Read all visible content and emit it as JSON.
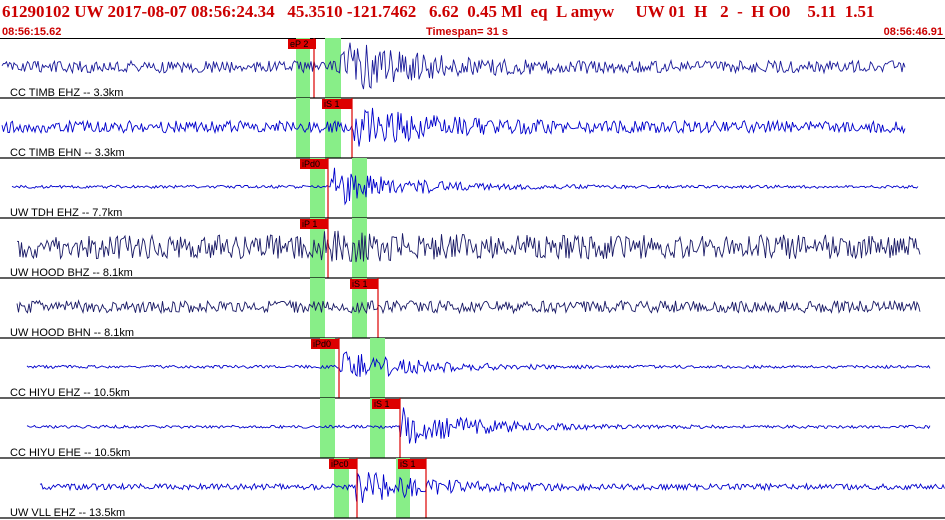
{
  "header": {
    "title": "61290102 UW 2017-08-07 08:56:24.34   45.3510 -121.7462   6.62  0.45 Ml  eq  L amyw     UW 01  H   2  -  H O0    5.11  1.51",
    "start_time": "08:56:15.62",
    "timespan": "Timespan=  31 s",
    "end_time": "08:56:46.91"
  },
  "colors": {
    "header_text": "#cc0000",
    "trace_blue": "#0000cc",
    "trace_navy": "#1a1a66",
    "pick_red": "#dd0000",
    "window_green": "#88ee88",
    "grid": "#000000"
  },
  "channels": [
    {
      "label": "CC TIMB EHZ -- 3.3km",
      "color": "navy-blue",
      "picks": [
        {
          "label": "eP 2",
          "phase": "P"
        }
      ]
    },
    {
      "label": "CC TIMB EHN -- 3.3km",
      "color": "blue",
      "picks": [
        {
          "label": "iS 1",
          "phase": "S"
        }
      ]
    },
    {
      "label": "UW TDH EHZ -- 7.7km",
      "color": "blue",
      "picks": [
        {
          "label": "iPd0",
          "phase": "P"
        }
      ]
    },
    {
      "label": "UW HOOD BHZ -- 8.1km",
      "color": "navy",
      "picks": [
        {
          "label": "iP 1",
          "phase": "P"
        }
      ]
    },
    {
      "label": "UW HOOD BHN -- 8.1km",
      "color": "navy",
      "picks": [
        {
          "label": "iS 1",
          "phase": "S"
        }
      ]
    },
    {
      "label": "CC HIYU EHZ -- 10.5km",
      "color": "blue",
      "picks": [
        {
          "label": "iPd0",
          "phase": "P"
        }
      ]
    },
    {
      "label": "CC HIYU EHE -- 10.5km",
      "color": "blue",
      "picks": [
        {
          "label": "iS 1",
          "phase": "S"
        }
      ]
    },
    {
      "label": "UW VLL EHZ -- 13.5km",
      "color": "blue",
      "picks": [
        {
          "label": "iPc0",
          "phase": "P"
        },
        {
          "label": "iS 1",
          "phase": "S"
        }
      ]
    }
  ]
}
